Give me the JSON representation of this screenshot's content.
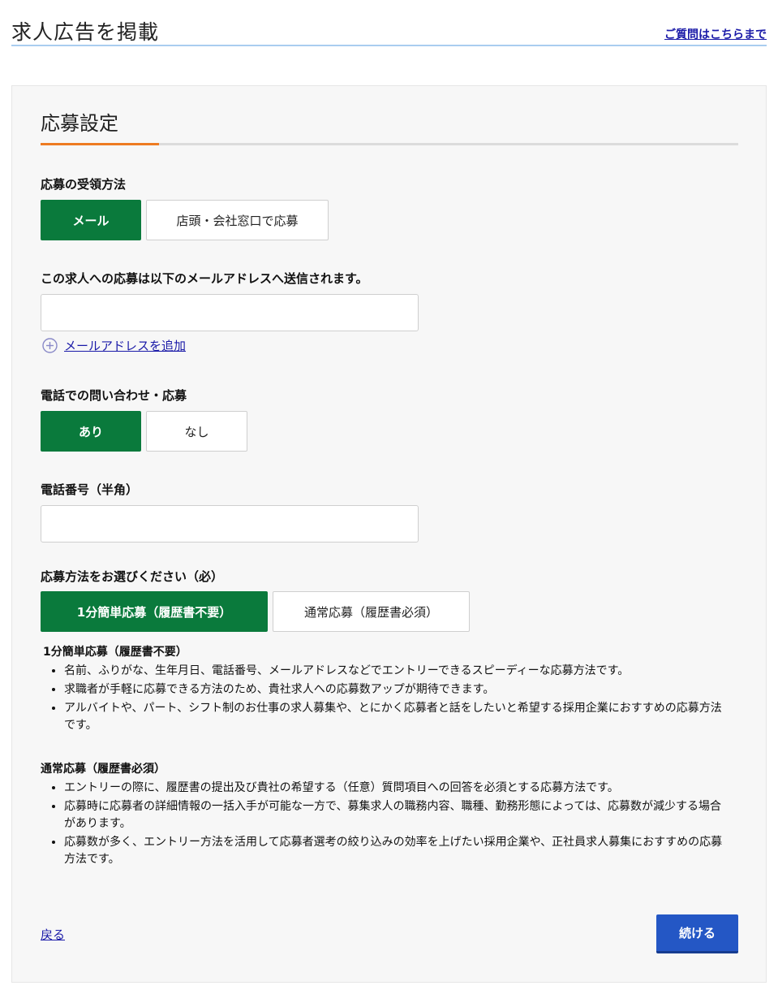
{
  "header": {
    "title": "求人広告を掲載",
    "help_link": "ご質問はこちらまで"
  },
  "section": {
    "title": "応募設定"
  },
  "receive_method": {
    "label": "応募の受領方法",
    "options": [
      "メール",
      "店頭・会社窓口で応募"
    ],
    "selected": "メール"
  },
  "email": {
    "label": "この求人への応募は以下のメールアドレスへ送信されます。",
    "value": "",
    "placeholder": "",
    "add_link": "メールアドレスを追加"
  },
  "phone_contact": {
    "label": "電話での問い合わせ・応募",
    "options": [
      "あり",
      "なし"
    ],
    "selected": "あり"
  },
  "phone_number": {
    "label": "電話番号（半角）",
    "value": "",
    "placeholder": ""
  },
  "apply_method": {
    "label": "応募方法をお選びください（必）",
    "options": [
      "1分簡単応募（履歴書不要）",
      "通常応募（履歴書必須）"
    ],
    "selected": "1分簡単応募（履歴書不要）"
  },
  "descriptions": [
    {
      "title": "1分簡単応募（履歴書不要）",
      "items": [
        "名前、ふりがな、生年月日、電話番号、メールアドレスなどでエントリーできるスピーディーな応募方法です。",
        "求職者が手軽に応募できる方法のため、貴社求人への応募数アップが期待できます。",
        "アルバイトや、パート、シフト制のお仕事の求人募集や、とにかく応募者と話をしたいと希望する採用企業におすすめの応募方法です。"
      ]
    },
    {
      "title": "通常応募（履歴書必須）",
      "items": [
        "エントリーの際に、履歴書の提出及び貴社の希望する（任意）質問項目への回答を必須とする応募方法です。",
        "応募時に応募者の詳細情報の一括入手が可能な一方で、募集求人の職務内容、職種、勤務形態によっては、応募数が減少する場合があります。",
        "応募数が多く、エントリー方法を活用して応募者選考の絞り込みの効率を上げたい採用企業や、正社員求人募集におすすめの応募方法です。"
      ]
    }
  ],
  "footer": {
    "back": "戻る",
    "continue": "続ける"
  },
  "colors": {
    "selected_green": "#0a7a3c",
    "accent_orange": "#ee7b22",
    "link_blue": "#1a1aa8",
    "primary_button": "#2457c5"
  },
  "icons": {
    "add_email": "plus-circle-icon"
  }
}
